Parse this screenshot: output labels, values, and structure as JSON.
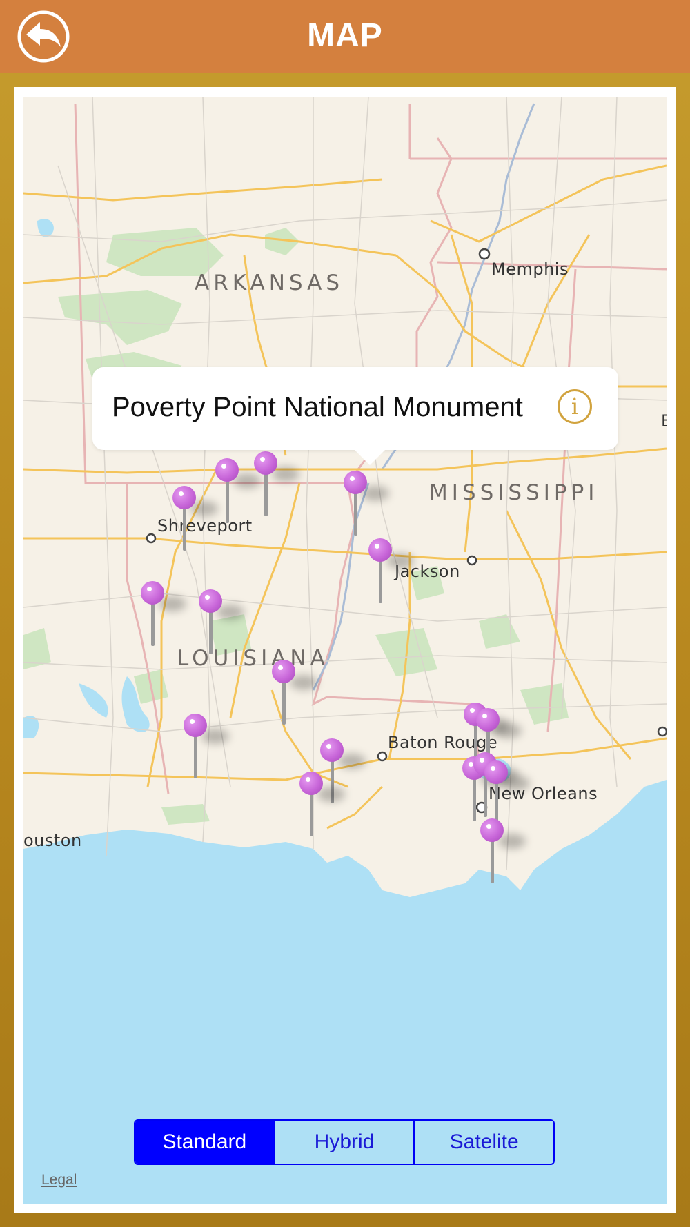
{
  "header": {
    "title": "MAP",
    "back_icon": "back-arrow-icon"
  },
  "map": {
    "states": [
      {
        "id": "arkansas",
        "label": "ARKANSAS"
      },
      {
        "id": "mississippi",
        "label": "MISSISSIPPI"
      },
      {
        "id": "louisiana",
        "label": "LOUISIANA"
      }
    ],
    "cities": [
      {
        "id": "memphis",
        "label": "Memphis"
      },
      {
        "id": "shreveport",
        "label": "Shreveport"
      },
      {
        "id": "jackson",
        "label": "Jackson"
      },
      {
        "id": "baton-rouge",
        "label": "Baton Rouge"
      },
      {
        "id": "new-orleans",
        "label": "New Orleans"
      },
      {
        "id": "houston",
        "label": "ouston"
      },
      {
        "id": "edge-b",
        "label": "B"
      }
    ],
    "pin_color": "#c765d8",
    "pin_count": 19
  },
  "callout": {
    "title": "Poverty Point National Monument",
    "info_icon": "info-icon"
  },
  "map_types": {
    "options": [
      "Standard",
      "Hybrid",
      "Satelite"
    ],
    "selected": "Standard"
  },
  "legal": "Legal",
  "colors": {
    "header": "#d4803e",
    "frame": "#b0831f",
    "water": "#aee0f5",
    "accent": "#0000ff"
  }
}
